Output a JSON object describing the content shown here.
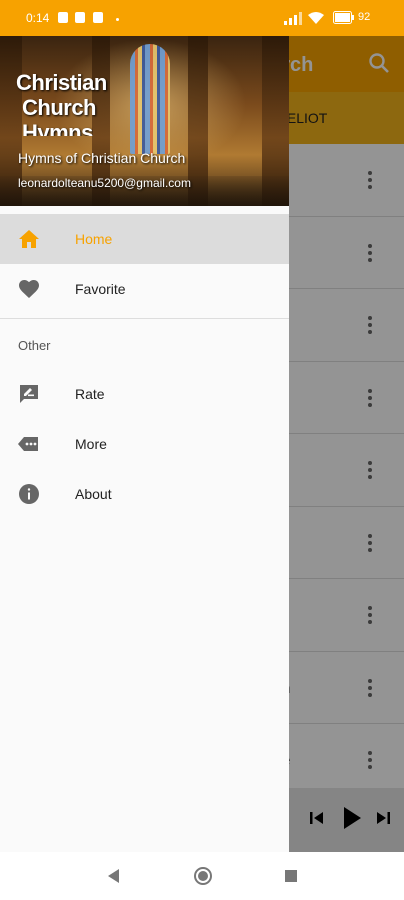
{
  "status_bar": {
    "time": "0:14",
    "battery": "92"
  },
  "app": {
    "toolbar_title": "urch",
    "subbar_label": "AM ELIOT",
    "rows": [
      "",
      "",
      "",
      "",
      "",
      "",
      "",
      "h",
      "e"
    ]
  },
  "drawer": {
    "header": {
      "logo_lines": [
        "Christian",
        "Church",
        "Hymns"
      ],
      "subtitle": "Hymns of Christian Church",
      "email": "leonardolteanu5200@gmail.com"
    },
    "items": [
      {
        "label": "Home",
        "icon": "home-icon",
        "active": true
      },
      {
        "label": "Favorite",
        "icon": "heart-icon",
        "active": false
      }
    ],
    "section_title": "Other",
    "other_items": [
      {
        "label": "Rate",
        "icon": "rate-review-icon"
      },
      {
        "label": "More",
        "icon": "more-label-icon"
      },
      {
        "label": "About",
        "icon": "info-icon"
      }
    ]
  },
  "colors": {
    "accent": "#f7a200",
    "active_bg": "#dcdcdc"
  }
}
